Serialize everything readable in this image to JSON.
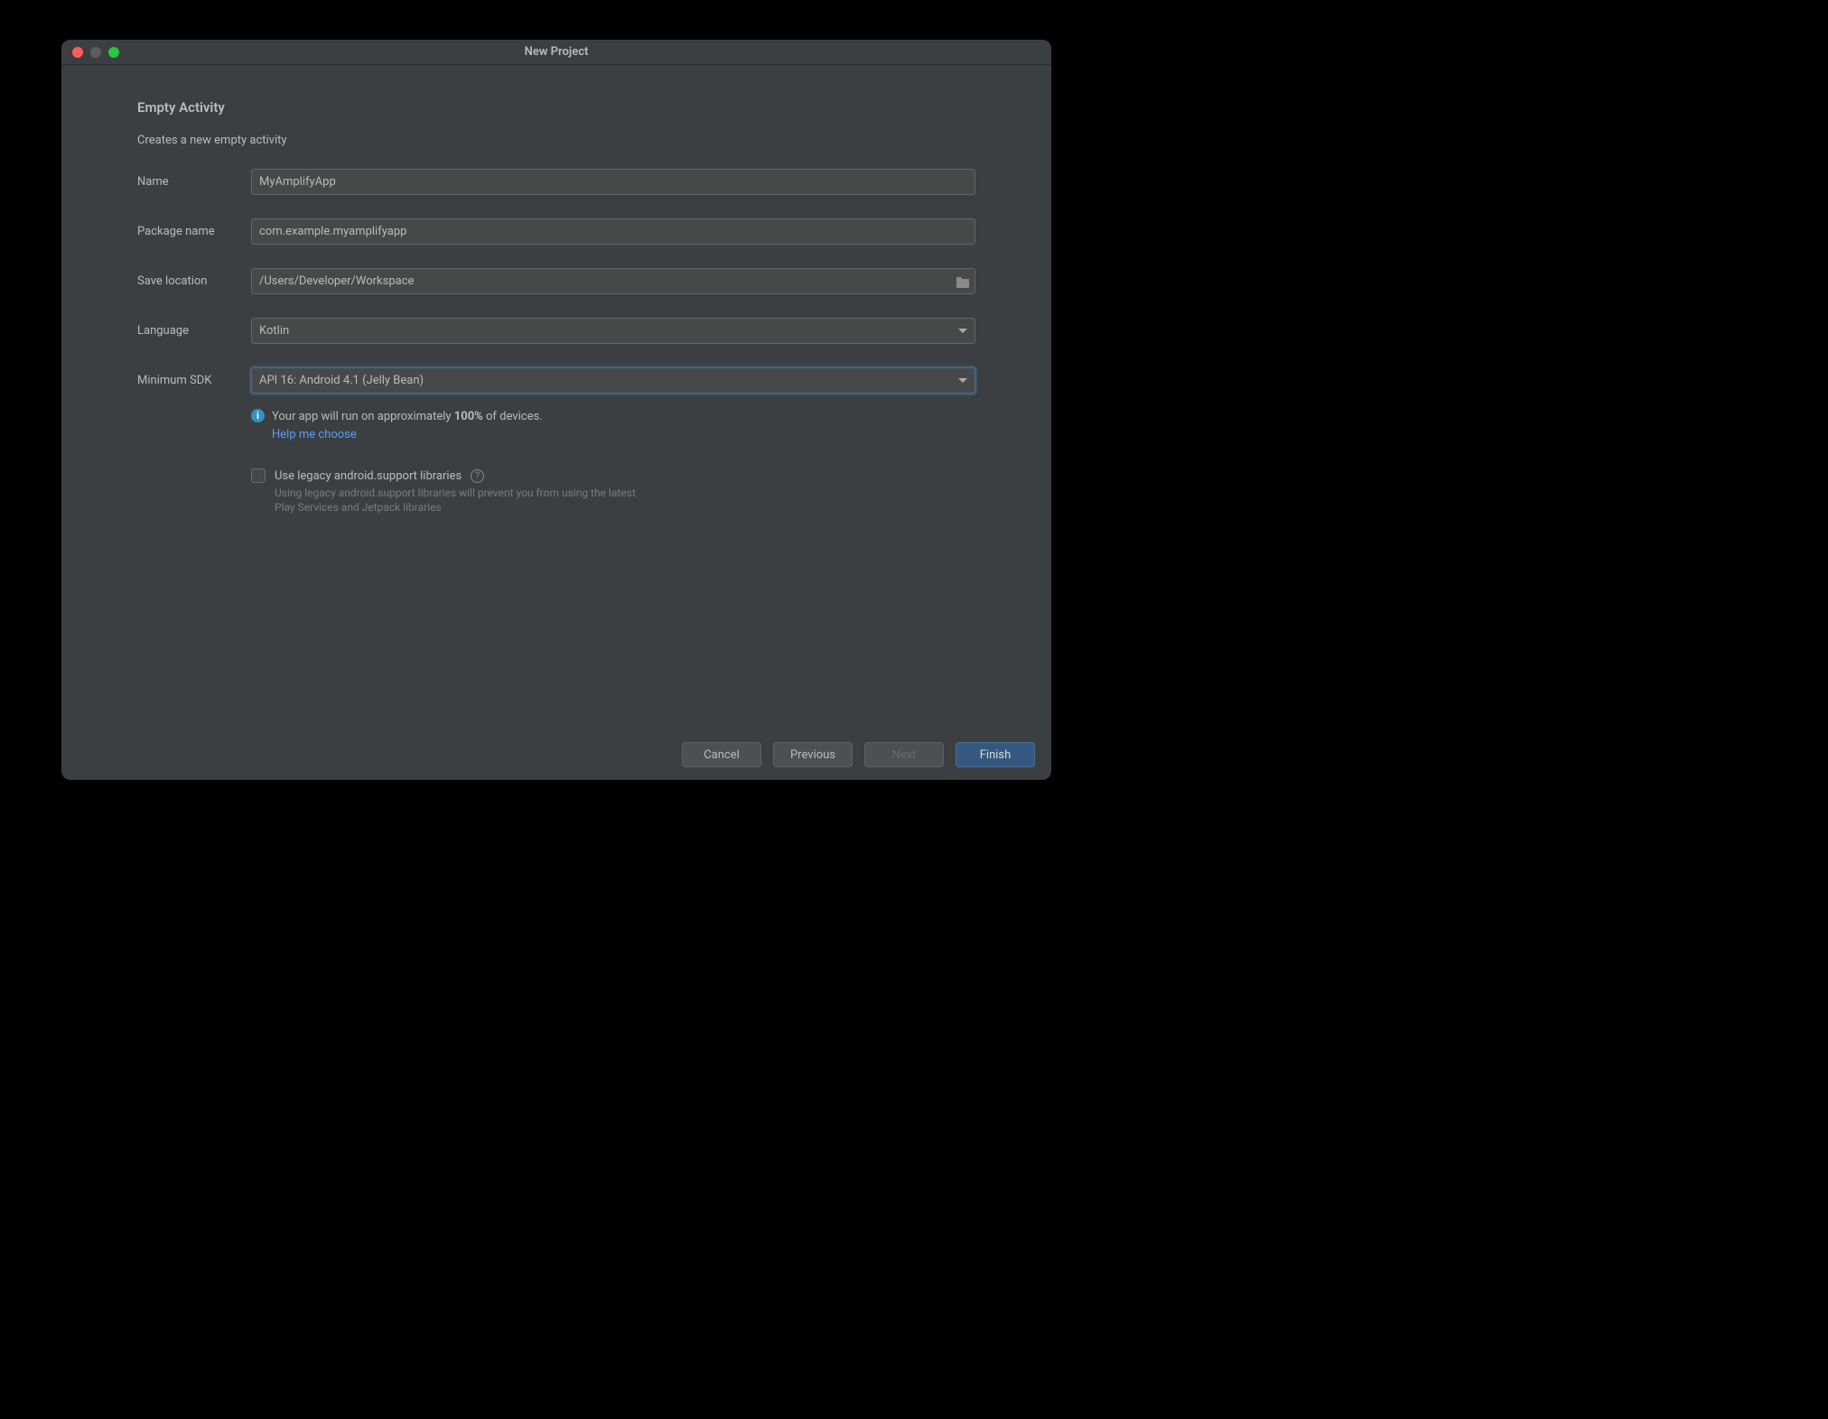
{
  "window": {
    "title": "New Project"
  },
  "form": {
    "heading": "Empty Activity",
    "description": "Creates a new empty activity",
    "name_label": "Name",
    "name_value": "MyAmplifyApp",
    "package_label": "Package name",
    "package_value": "com.example.myamplifyapp",
    "save_label": "Save location",
    "save_value": "/Users/Developer/Workspace",
    "language_label": "Language",
    "language_value": "Kotlin",
    "minsdk_label": "Minimum SDK",
    "minsdk_value": "API 16: Android 4.1 (Jelly Bean)"
  },
  "info": {
    "text_prefix": "Your app will run on approximately ",
    "text_bold": "100%",
    "text_suffix": " of devices.",
    "help_link": "Help me choose"
  },
  "legacy": {
    "label": "Use legacy android.support libraries",
    "hint": "Using legacy android.support libraries will prevent you from using the latest Play Services and Jetpack libraries"
  },
  "buttons": {
    "cancel": "Cancel",
    "previous": "Previous",
    "next": "Next",
    "finish": "Finish"
  }
}
